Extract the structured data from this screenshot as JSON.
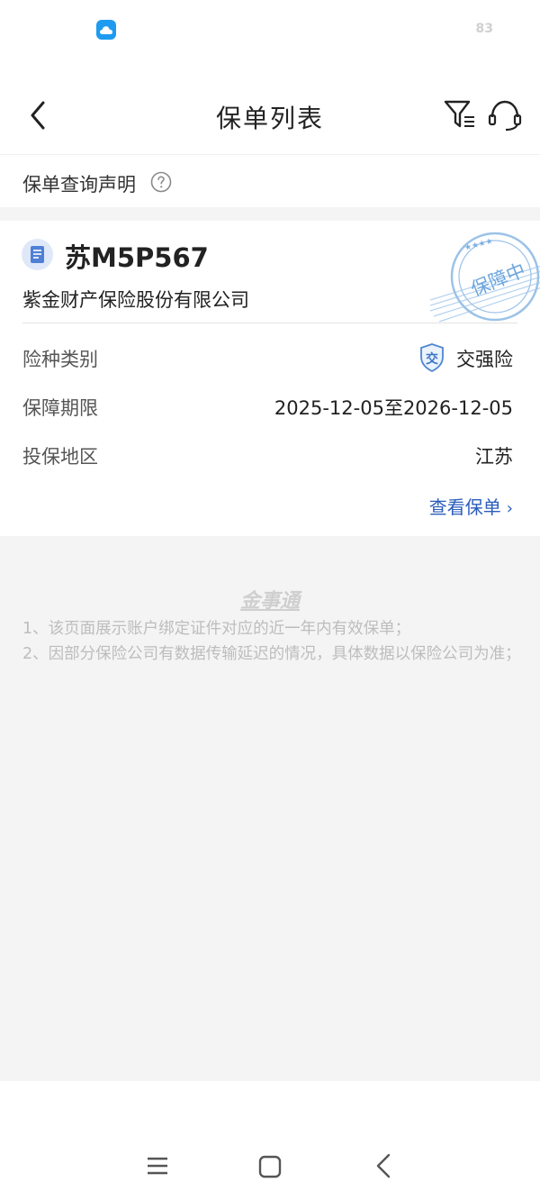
{
  "status_bar": {
    "app_icon": "cloud-app-icon",
    "battery": "83"
  },
  "nav": {
    "back_icon": "chevron-left-icon",
    "title": "保单列表",
    "filter_icon": "filter-icon",
    "service_icon": "headset-icon"
  },
  "notice": {
    "label": "保单查询声明",
    "help_icon": "question-circle-icon"
  },
  "policy": {
    "plate": "苏M5P567",
    "company": "紫金财产保险股份有限公司",
    "stamp_text": "保障中",
    "stamp_stars": "★★★★",
    "rows": [
      {
        "label": "险种类别",
        "value": "交强险",
        "badge": "交"
      },
      {
        "label": "保障期限",
        "value": "2025-12-05至2026-12-05"
      },
      {
        "label": "投保地区",
        "value": "江苏"
      }
    ],
    "view_link": "查看保单",
    "view_chevron": "›"
  },
  "footer": {
    "brand": "金事通",
    "notes": [
      "1、该页面展示账户绑定证件对应的近一年内有效保单；",
      "2、因部分保险公司有数据传输延迟的情况，具体数据以保险公司为准；"
    ]
  },
  "system_nav": {
    "menu_icon": "menu-icon",
    "home_icon": "home-square-icon",
    "back_icon": "back-triangle-icon"
  },
  "colors": {
    "accent_link": "#2a5dbb",
    "stamp_blue": "#7aaee0",
    "background": "#f4f4f4"
  }
}
